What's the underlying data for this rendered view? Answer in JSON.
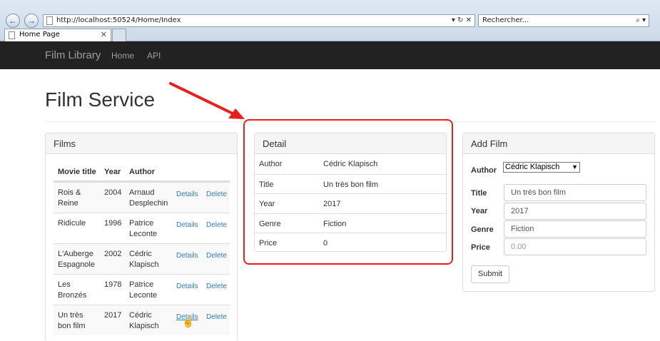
{
  "browser": {
    "url": "http://localhost:50524/Home/Index",
    "search_placeholder": "Rechercher...",
    "tab_title": "Home Page",
    "back_icon": "back-arrow-icon",
    "forward_icon": "forward-arrow-icon"
  },
  "navbar": {
    "brand": "Film Library",
    "links": [
      "Home",
      "API"
    ]
  },
  "page": {
    "title": "Film Service"
  },
  "films": {
    "heading": "Films",
    "columns": [
      "Movie title",
      "Year",
      "Author"
    ],
    "details_label": "Details",
    "delete_label": "Delete",
    "rows": [
      {
        "title1": "Rois &",
        "title2": "Reine",
        "year": "2004",
        "author1": "Arnaud",
        "author2": "Desplechin"
      },
      {
        "title1": "Ridicule",
        "title2": "",
        "year": "1996",
        "author1": "Patrice",
        "author2": "Leconte"
      },
      {
        "title1": "L'Auberge",
        "title2": "Espagnole",
        "year": "2002",
        "author1": "Cédric",
        "author2": "Klapisch"
      },
      {
        "title1": "Les",
        "title2": "Bronzés",
        "year": "1978",
        "author1": "Patrice",
        "author2": "Leconte"
      },
      {
        "title1": "Un très",
        "title2": "bon film",
        "year": "2017",
        "author1": "Cédric",
        "author2": "Klapisch"
      }
    ]
  },
  "detail": {
    "heading": "Detail",
    "rows": [
      {
        "label": "Author",
        "value": "Cédric Klapisch"
      },
      {
        "label": "Title",
        "value": "Un très bon film"
      },
      {
        "label": "Year",
        "value": "2017"
      },
      {
        "label": "Genre",
        "value": "Fiction"
      },
      {
        "label": "Price",
        "value": "0"
      }
    ]
  },
  "add_film": {
    "heading": "Add Film",
    "author_label": "Author",
    "author_selected": "Cédric Klapisch",
    "title_label": "Title",
    "title_value": "Un très bon film",
    "year_label": "Year",
    "year_value": "2017",
    "genre_label": "Genre",
    "genre_value": "Fiction",
    "price_label": "Price",
    "price_placeholder": "0.00",
    "submit_label": "Submit"
  },
  "colors": {
    "highlight": "#e8201d",
    "link": "#337ab7",
    "navbar": "#222222"
  }
}
